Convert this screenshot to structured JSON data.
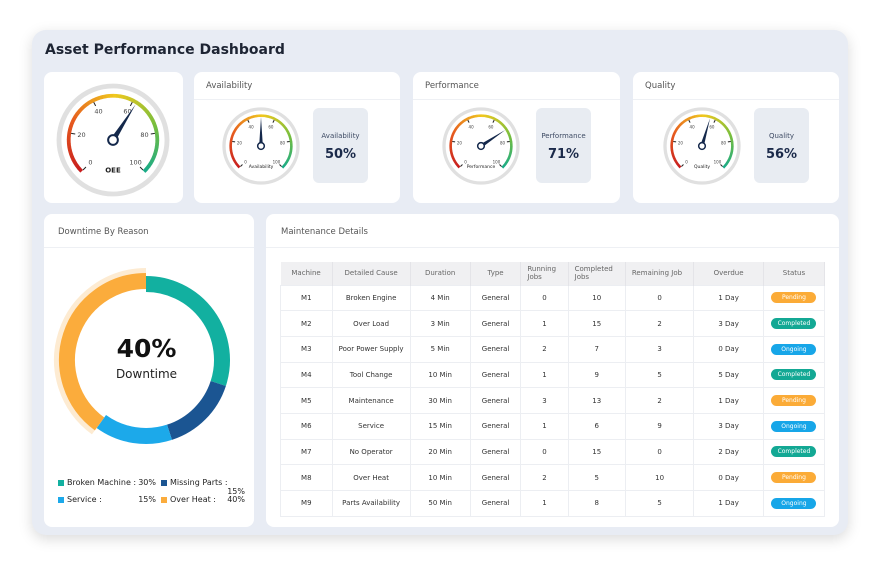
{
  "title": "Asset Performance Dashboard",
  "oee": {
    "label": "OEE",
    "value": 62,
    "ticks": [
      "0",
      "20",
      "40",
      "60",
      "80",
      "100"
    ]
  },
  "kpis": [
    {
      "header": "Availability",
      "gauge_label": "Availability",
      "box_label": "Availability",
      "value": 50,
      "display": "50%"
    },
    {
      "header": "Performance",
      "gauge_label": "Performance",
      "box_label": "Performance",
      "value": 71,
      "display": "71%"
    },
    {
      "header": "Quality",
      "gauge_label": "Quality",
      "box_label": "Quality",
      "value": 56,
      "display": "56%"
    }
  ],
  "downtime": {
    "header": "Downtime By Reason",
    "center_value": "40%",
    "center_label": "Downtime",
    "slices": [
      {
        "label": "Broken Machine :",
        "value": 30,
        "display": "30%",
        "color": "#12b0a0"
      },
      {
        "label": "Missing Parts :",
        "value": 15,
        "display": "15%",
        "color": "#1b5592"
      },
      {
        "label": "Service :",
        "value": 15,
        "display": "15%",
        "color": "#1ca9ea"
      },
      {
        "label": "Over Heat :",
        "value": 40,
        "display": "40%",
        "color": "#fbac3c"
      }
    ]
  },
  "maintenance": {
    "header": "Maintenance Details",
    "columns": [
      "Machine",
      "Detailed Cause",
      "Duration",
      "Type",
      "Running Jobs",
      "Completed Jobs",
      "Remaining Job",
      "Overdue",
      "Status"
    ],
    "rows": [
      [
        "M1",
        "Broken Engine",
        "4 Min",
        "General",
        "0",
        "10",
        "0",
        "1 Day",
        "Pending"
      ],
      [
        "M2",
        "Over Load",
        "3 Min",
        "General",
        "1",
        "15",
        "2",
        "3 Day",
        "Completed"
      ],
      [
        "M3",
        "Poor Power Supply",
        "5 Min",
        "General",
        "2",
        "7",
        "3",
        "0 Day",
        "Ongoing"
      ],
      [
        "M4",
        "Tool Change",
        "10 Min",
        "General",
        "1",
        "9",
        "5",
        "5 Day",
        "Completed"
      ],
      [
        "M5",
        "Maintenance",
        "30 Min",
        "General",
        "3",
        "13",
        "2",
        "1 Day",
        "Pending"
      ],
      [
        "M6",
        "Service",
        "15 Min",
        "General",
        "1",
        "6",
        "9",
        "3 Day",
        "Ongoing"
      ],
      [
        "M7",
        "No Operator",
        "20 Min",
        "General",
        "0",
        "15",
        "0",
        "2 Day",
        "Completed"
      ],
      [
        "M8",
        "Over Heat",
        "10 Min",
        "General",
        "2",
        "5",
        "10",
        "0 Day",
        "Pending"
      ],
      [
        "M9",
        "Parts Availability",
        "50 Min",
        "General",
        "1",
        "8",
        "5",
        "1 Day",
        "Ongoing"
      ]
    ],
    "status_colors": {
      "Pending": "#fbab37",
      "Completed": "#13a894",
      "Ongoing": "#17a6e8"
    }
  }
}
